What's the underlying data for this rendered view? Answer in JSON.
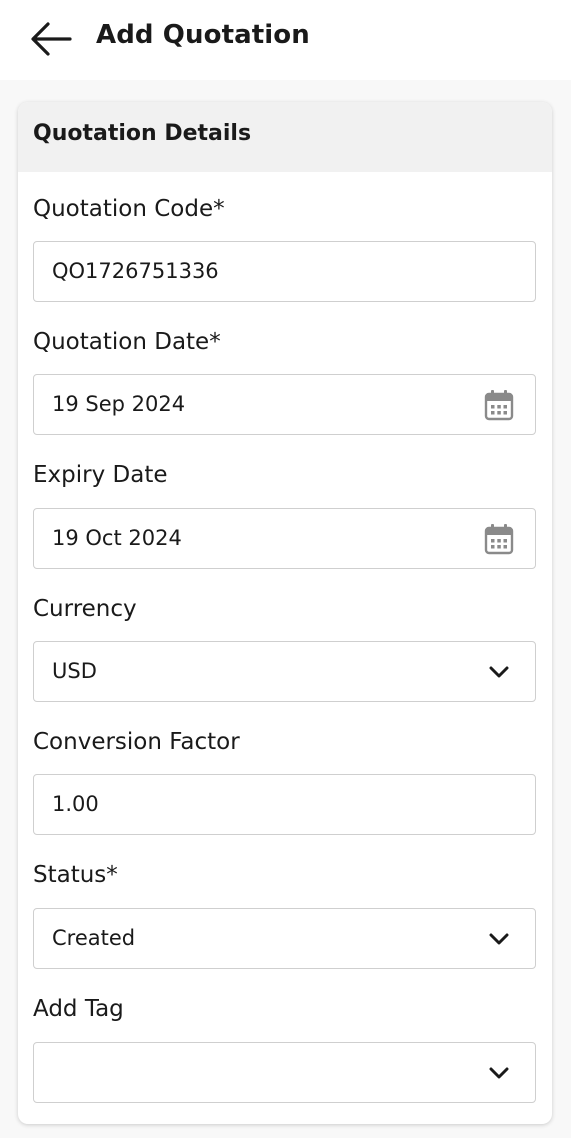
{
  "header": {
    "title": "Add Quotation",
    "back_icon": "arrow-left-icon"
  },
  "card": {
    "title": "Quotation Details"
  },
  "form": {
    "quotation_code": {
      "label": "Quotation Code*",
      "value": "QO1726751336"
    },
    "quotation_date": {
      "label": "Quotation Date*",
      "value": "19 Sep 2024",
      "icon": "calendar-icon"
    },
    "expiry_date": {
      "label": "Expiry Date",
      "value": "19 Oct 2024",
      "icon": "calendar-icon"
    },
    "currency": {
      "label": "Currency",
      "value": "USD",
      "icon": "chevron-down-icon"
    },
    "conversion_factor": {
      "label": "Conversion Factor",
      "value": "1.00"
    },
    "status": {
      "label": "Status*",
      "value": "Created",
      "icon": "chevron-down-icon"
    },
    "add_tag": {
      "label": "Add Tag",
      "value": "",
      "icon": "chevron-down-icon"
    }
  },
  "colors": {
    "app_bar_bg": "#ffffff",
    "page_bg": "#f8f8f8",
    "card_header_bg": "#f1f1f1",
    "border": "#cfcfcf",
    "icon_gray": "#8a8a8a",
    "text": "#1a1a1a"
  }
}
